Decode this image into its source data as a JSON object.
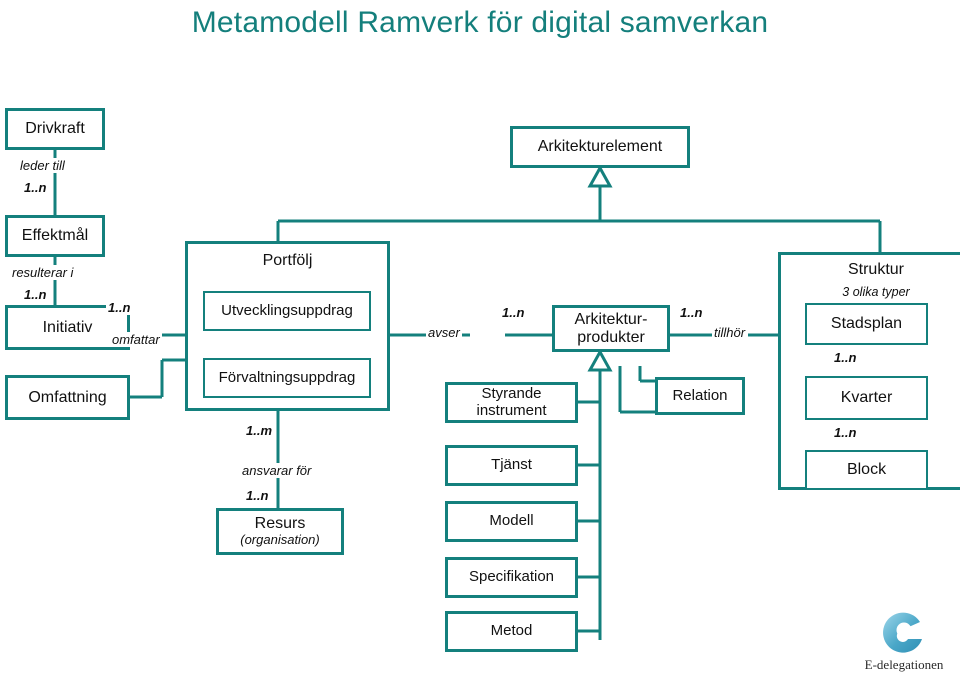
{
  "title": "Metamodell Ramverk för digital samverkan",
  "theme": {
    "line_color": "#14807d",
    "title_color": "#147f7c",
    "text_color": "#111111",
    "background": "#ffffff"
  },
  "boxes": {
    "drivkraft": "Drivkraft",
    "effektmal": "Effektmål",
    "initiativ": "Initiativ",
    "omfattning": "Omfattning",
    "portfolj": "Portfölj",
    "utvecklingsuppdrag": "Utvecklingsuppdrag",
    "forvaltningsuppdrag": "Förvaltningsuppdrag",
    "resurs_line1": "Resurs",
    "resurs_line2": "(organisation)",
    "arkitekturelement": "Arkitekturelement",
    "arkitekturprodukter_line1": "Arkitektur-",
    "arkitekturprodukter_line2": "produkter",
    "styrande_line1": "Styrande",
    "styrande_line2": "instrument",
    "tjanst": "Tjänst",
    "modell": "Modell",
    "specifikation": "Specifikation",
    "metod": "Metod",
    "relation": "Relation",
    "struktur": "Struktur",
    "struktur_note": "3 olika typer",
    "stadsplan": "Stadsplan",
    "kvarter": "Kvarter",
    "block": "Block"
  },
  "edges": {
    "leder_till": "leder till",
    "leder_till_mult": "1..n",
    "resulterar_i": "resulterar i",
    "resulterar_i_mult": "1..n",
    "omfattar": "omfattar",
    "omfattar_mult": "1..n",
    "ansvarar_for": "ansvarar för",
    "ansvarar_for_mult_top": "1..m",
    "ansvarar_for_mult_bottom": "1..n",
    "avser": "avser",
    "avser_mult": "1..n",
    "tillhor": "tillhör",
    "tillhor_mult": "1..n",
    "stadsplan_kvarter_mult": "1..n",
    "kvarter_block_mult": "1..n"
  },
  "logo": {
    "name": "E-delegationen",
    "mark": "e-swirl-logo"
  }
}
